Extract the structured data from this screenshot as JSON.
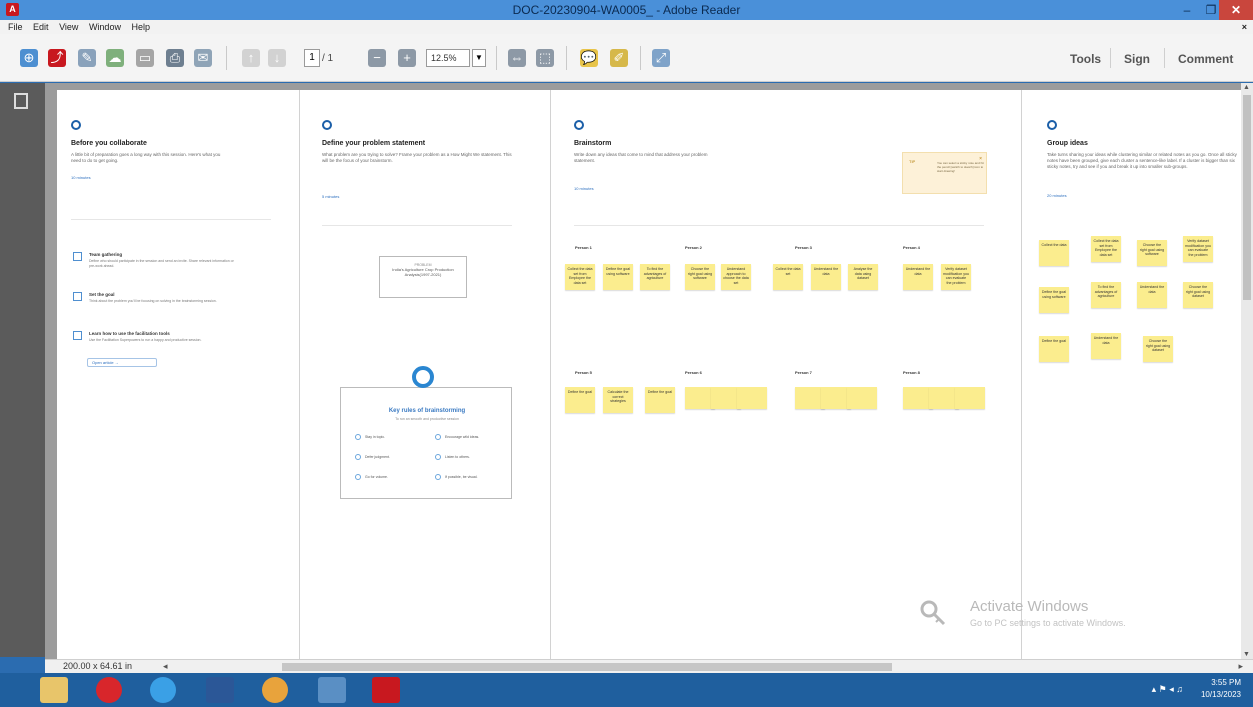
{
  "window": {
    "title": "DOC-20230904-WA0005_ - Adobe Reader",
    "minimize_glyph": "–",
    "maximize_glyph": "❐",
    "close_glyph": "✕"
  },
  "menu": [
    "File",
    "Edit",
    "View",
    "Window",
    "Help"
  ],
  "menu_close_glyph": "×",
  "toolbar": {
    "page_current": "1",
    "page_total": "/ 1",
    "zoom": "12.5%",
    "zoom_drop_glyph": "▼",
    "links": [
      "Tools",
      "Sign",
      "Comment"
    ]
  },
  "sections": [
    {
      "number_icon": "circle-icon",
      "title": "Before you collaborate",
      "text": "A little bit of preparation goes a long way with this session. Here's what you need to do to get going.",
      "time": "10 minutes",
      "checklist": [
        {
          "title": "Team gathering",
          "text": "Define who should participate in the session and send an invite. Share relevant information or pre-work ahead."
        },
        {
          "title": "Set the goal",
          "text": "Think about the problem you'll be focusing on solving in the brainstorming session."
        },
        {
          "title": "Learn how to use the facilitation tools",
          "text": "Use the Facilitation Superpowers to run a happy and productive session."
        }
      ],
      "share_button": "Open article  →"
    },
    {
      "title": "Define your problem statement",
      "text": "What problem are you trying to solve? Frame your problem as a How Might We statement. This will be the focus of your brainstorm.",
      "time": "5 minutes",
      "card_label": "PROBLEM",
      "card_text": "India's Agriculture Crop Production Analysis(1997-2021)",
      "rules_title": "Key rules of brainstorming",
      "rules_sub": "To run an smooth and productive session",
      "rules": [
        "Stay in topic.",
        "Encourage wild ideas.",
        "Defer judgment.",
        "Listen to others.",
        "Go for volume.",
        "If possible, be visual."
      ]
    },
    {
      "title": "Brainstorm",
      "text": "Write down any ideas that come to mind that address your problem statement.",
      "time": "10 minutes",
      "tip_title": "TIP",
      "tip_text": "You can select a sticky note and hit the pencil [switch to sketch] icon to start drawing!",
      "tip_close": "×",
      "persons": [
        "Person 1",
        "Person 2",
        "Person 3",
        "Person 4",
        "Person 5",
        "Person 6",
        "Person 7",
        "Person 8"
      ],
      "stickies_row1": [
        "Collect the data set from Employee the data set",
        "Define the goal using software",
        "To find the advantages of agriculture",
        "Choose the right goal using software",
        "Understand approach to choose the data set",
        "Collect the data set",
        "Understand the data",
        "Analyse the data using dataset",
        "Understand the data",
        "Verify dataset modification you can evaluate the problem"
      ],
      "stickies_row2": [
        "Define the goal",
        "Calculate the correct strategies",
        "Define the goal"
      ]
    },
    {
      "title": "Group ideas",
      "text": "Take turns sharing your ideas while clustering similar or related notes as you go. Once all sticky notes have been grouped, give each cluster a sentence-like label. If a cluster is bigger than six sticky notes, try and see if you and break it up into smaller sub-groups.",
      "time": "20 minutes",
      "stickies": [
        "Collect the data",
        "Collect the data set from Employee the data set",
        "Choose the right goal using software",
        "Verify dataset modification you can evaluate the problem",
        "Define the goal using software",
        "To find the advantages of agriculture",
        "Understand the data",
        "Choose the right goal using dataset",
        "Define the goal",
        "Understand the data",
        "Choose the right goal using dataset"
      ]
    }
  ],
  "watermark": {
    "line1": "Activate Windows",
    "line2": "Go to PC settings to activate Windows."
  },
  "statusbar": {
    "dims": "200.00 x 64.61 in"
  },
  "taskbar": {
    "time": "3:55 PM",
    "date": "10/13/2023"
  },
  "colors": {
    "titlebar": "#4a90d9",
    "taskbar": "#1f5f9e",
    "sticky": "#fbed8e",
    "accent": "#1b5fa8"
  }
}
